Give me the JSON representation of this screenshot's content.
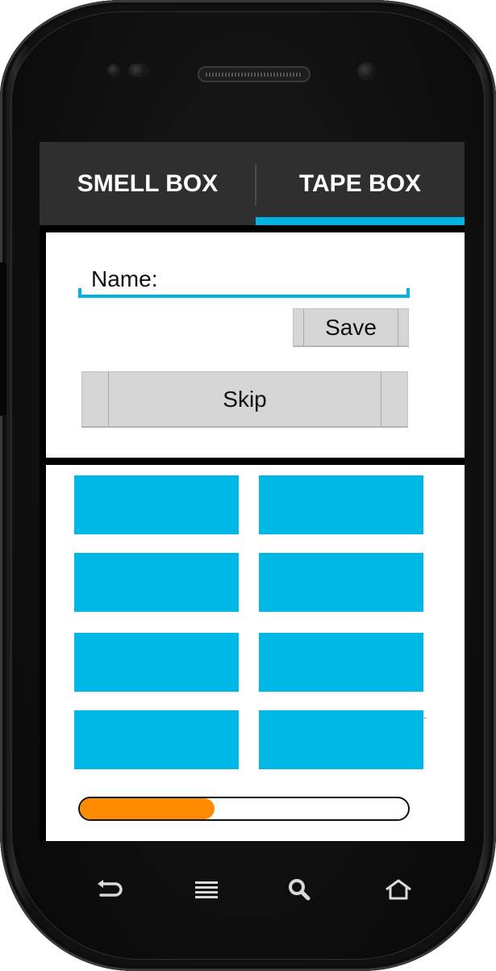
{
  "tabs": [
    {
      "label": "SMELL BOX",
      "selected": false
    },
    {
      "label": "TAPE BOX",
      "selected": true
    }
  ],
  "form": {
    "name_label": "Name:",
    "save_label": "Save",
    "skip_label": "Skip"
  },
  "grid": {
    "rows": 4,
    "columns": 2,
    "tile_color": "#00b8e6"
  },
  "progress": {
    "value_percent": 41,
    "fill_color": "#ff8c00"
  },
  "nav_icons": [
    "back-icon",
    "menu-icon",
    "search-icon",
    "home-icon"
  ],
  "colors": {
    "accent": "#00b3e3",
    "tab_bar": "#2f2f2f"
  }
}
